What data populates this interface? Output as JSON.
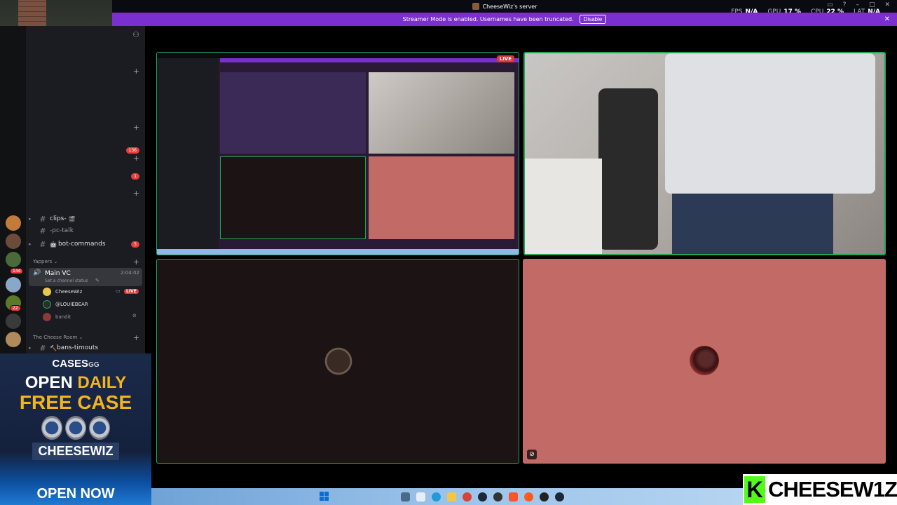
{
  "window": {
    "title": "CheeseWiz's server"
  },
  "perf": [
    {
      "label": "FPS",
      "value": "N/A"
    },
    {
      "label": "GPU",
      "value": "17 %"
    },
    {
      "label": "CPU",
      "value": "22 %"
    },
    {
      "label": "LAT",
      "value": "N/A"
    }
  ],
  "banner": {
    "text": "Streamer Mode is enabled. Usernames have been truncated.",
    "button": "Disable",
    "close": "✕"
  },
  "rail": {
    "badges": [
      "136",
      "1",
      "144",
      "22"
    ]
  },
  "sidebar": {
    "plus": "+",
    "channels": [
      {
        "name": "clips-",
        "prefix": "#",
        "emoji": "🎬"
      },
      {
        "name": "-pc-talk",
        "prefix": "#"
      },
      {
        "name": "bot-commands",
        "prefix": "#",
        "emoji": "🤖",
        "badge": "5"
      }
    ],
    "category_yappers": "Yappers",
    "voice": {
      "name": "Main VC",
      "time": "2:04:02",
      "status_placeholder": "Set a channel status",
      "users": [
        {
          "name": "CheeseWiz",
          "live": "LIVE",
          "color": "#e6c84a"
        },
        {
          "name": "@LOUIEBEAR",
          "color": "#2c2c2c"
        },
        {
          "name": "bandit",
          "color": "#8a3a3a"
        }
      ]
    },
    "category_cheese": "The Cheese Room",
    "last_channel": "bans-timouts"
  },
  "grid": {
    "live": "LIVE"
  },
  "ad": {
    "brand": "CASES",
    "brand_suffix": "GG",
    "line1_a": "OPEN ",
    "line1_b": "DAILY",
    "line2": "FREE CASE",
    "code": "CHEESEWIZ",
    "cta": "OPEN NOW"
  },
  "kick": {
    "logo": "K",
    "name": "CHEESEW1Z"
  },
  "colors": {
    "accent": "#7b2fd0",
    "speaking": "#23a55a",
    "live": "#da373c",
    "kick_green": "#53fc18"
  }
}
